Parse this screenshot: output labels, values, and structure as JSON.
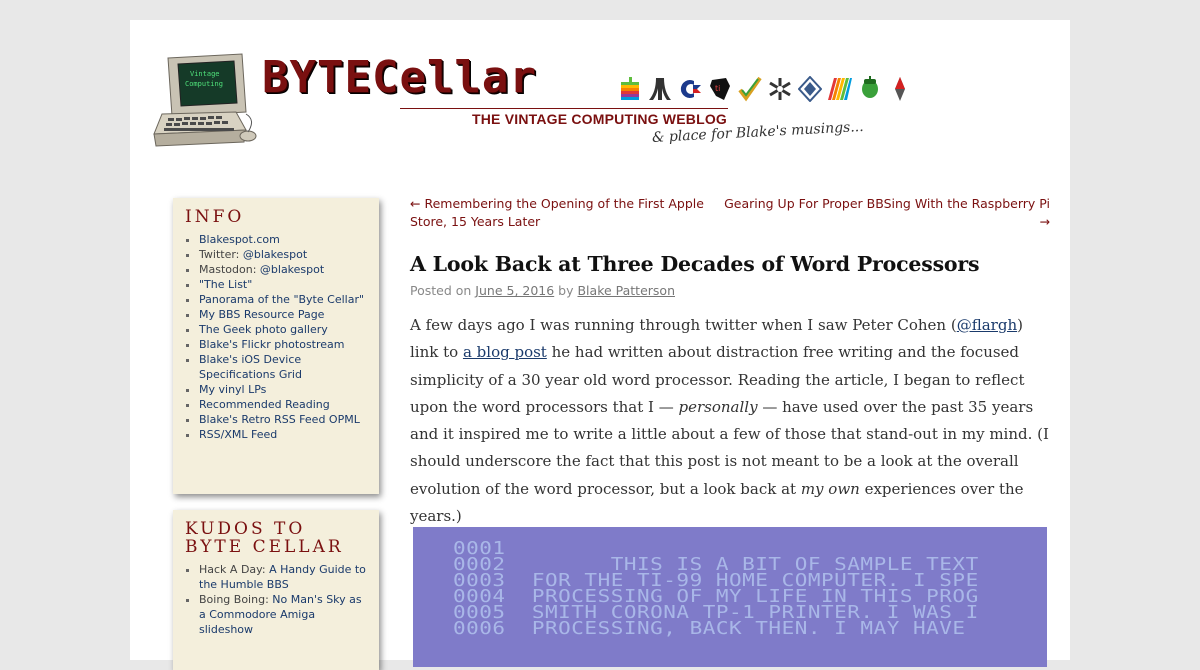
{
  "site": {
    "logo_text": "BYTECellar",
    "tagline": "THE VINTAGE COMPUTING WEBLOG",
    "subtagline": "& place for Blake's musings...",
    "screen_label_line1": "Vintage",
    "screen_label_line2": "Computing",
    "icons": [
      "apple-logo-icon",
      "atari-logo-icon",
      "commodore-logo-icon",
      "ti-logo-icon",
      "check-logo-icon",
      "snowflake-logo-icon",
      "diamond-logo-icon",
      "rainbow-stripes-icon",
      "acorn-logo-icon",
      "compass-logo-icon"
    ]
  },
  "sidebar": {
    "info": {
      "title": "INFO",
      "items": [
        {
          "prefix": "",
          "link": "Blakespot.com"
        },
        {
          "prefix": "Twitter: ",
          "link": "@blakespot"
        },
        {
          "prefix": "Mastodon: ",
          "link": "@blakespot"
        },
        {
          "prefix": "",
          "link": "\"The List\""
        },
        {
          "prefix": "",
          "link": "Panorama of the \"Byte Cellar\""
        },
        {
          "prefix": "",
          "link": "My BBS Resource Page"
        },
        {
          "prefix": "",
          "link": "The Geek photo gallery"
        },
        {
          "prefix": "",
          "link": "Blake's Flickr photostream"
        },
        {
          "prefix": "",
          "link": "Blake's iOS Device Specifications Grid"
        },
        {
          "prefix": "",
          "link": "My vinyl LPs"
        },
        {
          "prefix": "",
          "link": "Recommended Reading"
        },
        {
          "prefix": "",
          "link": "Blake's Retro RSS Feed OPML"
        },
        {
          "prefix": "",
          "link": "RSS/XML Feed"
        }
      ]
    },
    "kudos": {
      "title_line1": "KUDOS TO",
      "title_line2": "BYTE CELLAR",
      "items": [
        {
          "prefix": "Hack A Day: ",
          "link": "A Handy Guide to the Humble BBS"
        },
        {
          "prefix": "Boing Boing: ",
          "link": "No Man's Sky as a Commodore Amiga slideshow"
        }
      ]
    }
  },
  "post": {
    "nav_prev": "← Remembering the Opening of the First Apple Store, 15 Years Later",
    "nav_next": "Gearing Up For Proper BBSing With the Raspberry Pi →",
    "title": "A Look Back at Three Decades of Word Processors",
    "meta_posted_on": "Posted on ",
    "meta_date": "June 5, 2016",
    "meta_by": " by ",
    "meta_author": "Blake Patterson",
    "body": {
      "p1": "A few days ago I was running through twitter when I saw Peter Cohen (",
      "link_flargh": "@flargh",
      "p2": ") link to ",
      "link_blogpost": "a blog post",
      "p3": " he had written about distraction free writing and the focused simplicity of a 30 year old word processor. Reading the article, I began to reflect upon the word processors that I — ",
      "em_personally": "personally",
      "p4": " — have used over the past 35 years and it inspired me to write a little about a few of those that stand-out in my mind. (I should underscore the fact that this post is not meant to be a look at the overall evolution of the word processor, but a look back at ",
      "em_myown": "my own",
      "p5": " experiences over the years.)"
    },
    "screen_lines": [
      "0001",
      "0002        THIS IS A BIT OF SAMPLE TEXT",
      "0003  FOR THE TI-99 HOME COMPUTER. I SPE",
      "0004  PROCESSING OF MY LIFE IN THIS PROG",
      "0005  SMITH CORONA TP-1 PRINTER. I WAS I",
      "0006  PROCESSING, BACK THEN. I MAY HAVE"
    ]
  },
  "colors": {
    "accent": "#7a1010",
    "link": "#1a3a6b",
    "widget_bg": "#f4efdc",
    "ti_bg": "#7f7bc9"
  }
}
